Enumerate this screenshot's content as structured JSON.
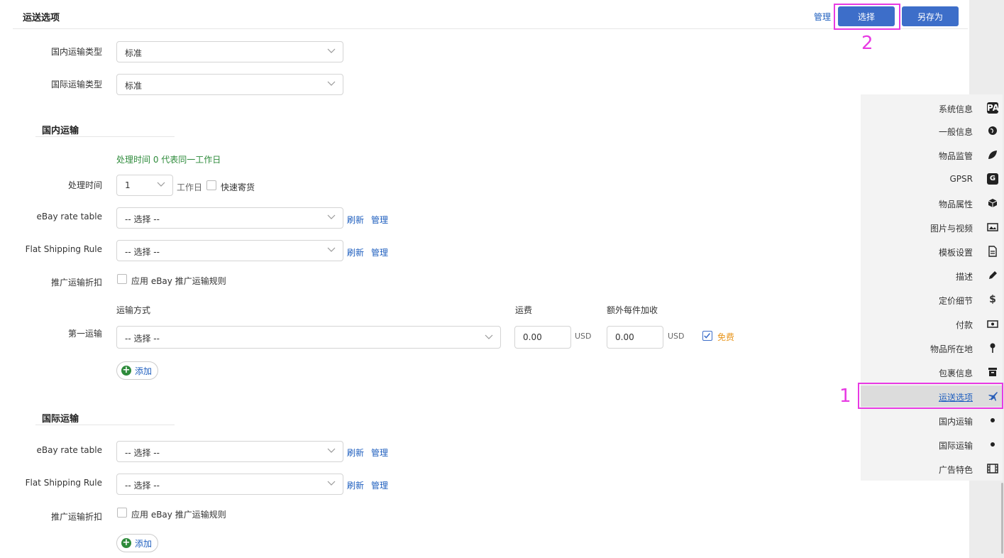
{
  "header": {
    "title": "运送选项",
    "manage_label": "管理",
    "select_label": "选择",
    "save_as_label": "另存为"
  },
  "shipping_type": {
    "domestic_label": "国内运输类型",
    "domestic_value": "标准",
    "intl_label": "国际运输类型",
    "intl_value": "标准"
  },
  "domestic": {
    "section_title": "国内运输",
    "hint": "处理时间 0 代表同一工作日",
    "handling_label": "处理时间",
    "handling_value": "1",
    "workday_label": "工作日",
    "express_label": "快速寄货",
    "rate_table_label": "eBay rate table",
    "rate_table_value": "-- 选择 --",
    "flat_rule_label": "Flat Shipping Rule",
    "flat_rule_value": "-- 选择 --",
    "refresh_label": "刷新",
    "manage_label": "管理",
    "promo_label": "推广运输折扣",
    "promo_checkbox_label": "应用 eBay 推广运输规则",
    "col_method": "运输方式",
    "col_fee": "运费",
    "col_extra": "额外每件加收",
    "first_label": "第一运输",
    "method_value": "-- 选择 --",
    "fee_value": "0.00",
    "extra_value": "0.00",
    "currency": "USD",
    "free_label": "免费",
    "add_label": "添加"
  },
  "international": {
    "section_title": "国际运输",
    "rate_table_label": "eBay rate table",
    "rate_table_value": "-- 选择 --",
    "flat_rule_label": "Flat Shipping Rule",
    "flat_rule_value": "-- 选择 --",
    "refresh_label": "刷新",
    "manage_label": "管理",
    "promo_label": "推广运输折扣",
    "promo_checkbox_label": "应用 eBay 推广运输规则",
    "add_label": "添加"
  },
  "nav": {
    "items": [
      {
        "label": "系统信息",
        "icon": "pa-badge-icon"
      },
      {
        "label": "一般信息",
        "icon": "globe-icon"
      },
      {
        "label": "物品监管",
        "icon": "leaf-icon"
      },
      {
        "label": "GPSR",
        "icon": "g-badge-icon"
      },
      {
        "label": "物品属性",
        "icon": "cube-icon"
      },
      {
        "label": "图片与视频",
        "icon": "image-icon"
      },
      {
        "label": "模板设置",
        "icon": "document-icon"
      },
      {
        "label": "描述",
        "icon": "pencil-icon"
      },
      {
        "label": "定价细节",
        "icon": "dollar-icon"
      },
      {
        "label": "付款",
        "icon": "money-icon"
      },
      {
        "label": "物品所在地",
        "icon": "pin-icon"
      },
      {
        "label": "包裹信息",
        "icon": "archive-icon"
      },
      {
        "label": "运送选项",
        "icon": "plane-icon"
      },
      {
        "label": "国内运输",
        "icon": "dot-icon"
      },
      {
        "label": "国际运输",
        "icon": "dot-icon"
      },
      {
        "label": "广告特色",
        "icon": "film-icon"
      }
    ],
    "pa_text": "PA",
    "g_text": "G",
    "dollar_text": "$"
  },
  "annotations": {
    "marker_1": "1",
    "marker_2": "2",
    "color": "#e83ae3"
  },
  "colors": {
    "accent": "#3d6ec9",
    "link": "#1f5fbf",
    "hint_green": "#2e8b3b",
    "free_orange": "#e8951c"
  }
}
